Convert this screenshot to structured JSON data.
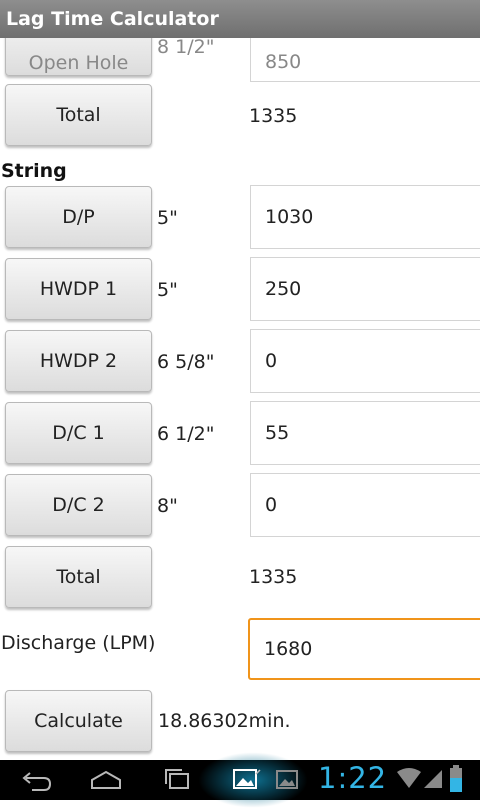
{
  "app": {
    "title": "Lag Time Calculator"
  },
  "hole": {
    "open_hole": {
      "button": "Open Hole",
      "size": "8 1/2\"",
      "value": "850"
    },
    "total": {
      "button": "Total",
      "value": "1335"
    }
  },
  "string": {
    "heading": "String",
    "rows": [
      {
        "button": "D/P",
        "size": "5\"",
        "value": "1030"
      },
      {
        "button": "HWDP 1",
        "size": "5\"",
        "value": "250"
      },
      {
        "button": "HWDP 2",
        "size": "6 5/8\"",
        "value": "0"
      },
      {
        "button": "D/C 1",
        "size": "6 1/2\"",
        "value": "55"
      },
      {
        "button": "D/C 2",
        "size": "8\"",
        "value": "0"
      }
    ],
    "total": {
      "button": "Total",
      "value": "1335"
    }
  },
  "discharge": {
    "label": "Discharge (LPM)",
    "value": "1680"
  },
  "calculate": {
    "button": "Calculate",
    "result": "18.86302min."
  },
  "status": {
    "time": "1:22",
    "accent_color": "#33b5e5",
    "icons": [
      "back-icon",
      "home-icon",
      "recent-apps-icon",
      "gallery-icon",
      "image-icon",
      "wifi-icon",
      "signal-icon",
      "battery-icon"
    ]
  }
}
